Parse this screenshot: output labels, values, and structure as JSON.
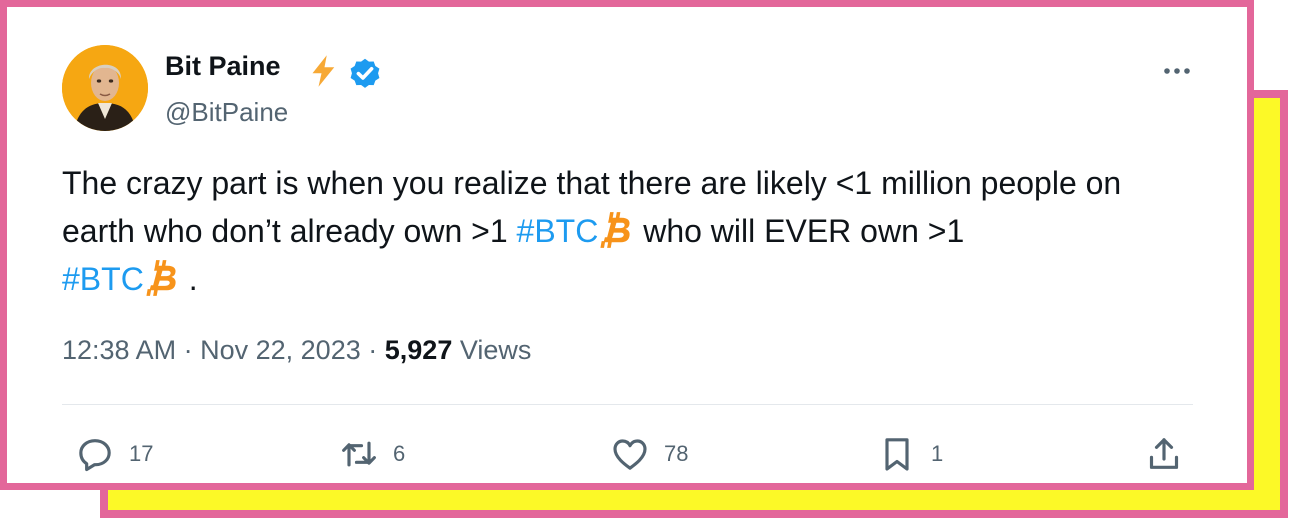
{
  "author": {
    "name": "Bit Paine",
    "handle": "@BitPaine"
  },
  "tweet": {
    "text_part1": "The crazy part is when you realize that there are likely <1 million people on earth who don’t already own >1 ",
    "hashtag1": "#BTC",
    "text_part2": " who will EVER own >1 ",
    "hashtag2": "#BTC",
    "text_part3": "."
  },
  "meta": {
    "time": "12:38 AM",
    "separator": "·",
    "date": "Nov 22, 2023",
    "views_count": "5,927",
    "views_label": "Views"
  },
  "actions": {
    "replies": "17",
    "retweets": "6",
    "likes": "78",
    "bookmarks": "1"
  },
  "colors": {
    "frame_border": "#e3679a",
    "shadow_fill": "#fcf927",
    "link": "#1d9bf0",
    "verified": "#1d9bf0",
    "bitcoin": "#f7931a",
    "bolt": "#f7a936"
  },
  "icons": {
    "bolt": "lightning-bolt-icon",
    "verified": "verified-badge-icon",
    "more": "more-horizontal-icon",
    "bitcoin": "bitcoin-icon",
    "reply": "reply-icon",
    "retweet": "retweet-icon",
    "like": "heart-icon",
    "bookmark": "bookmark-icon",
    "share": "share-icon"
  }
}
